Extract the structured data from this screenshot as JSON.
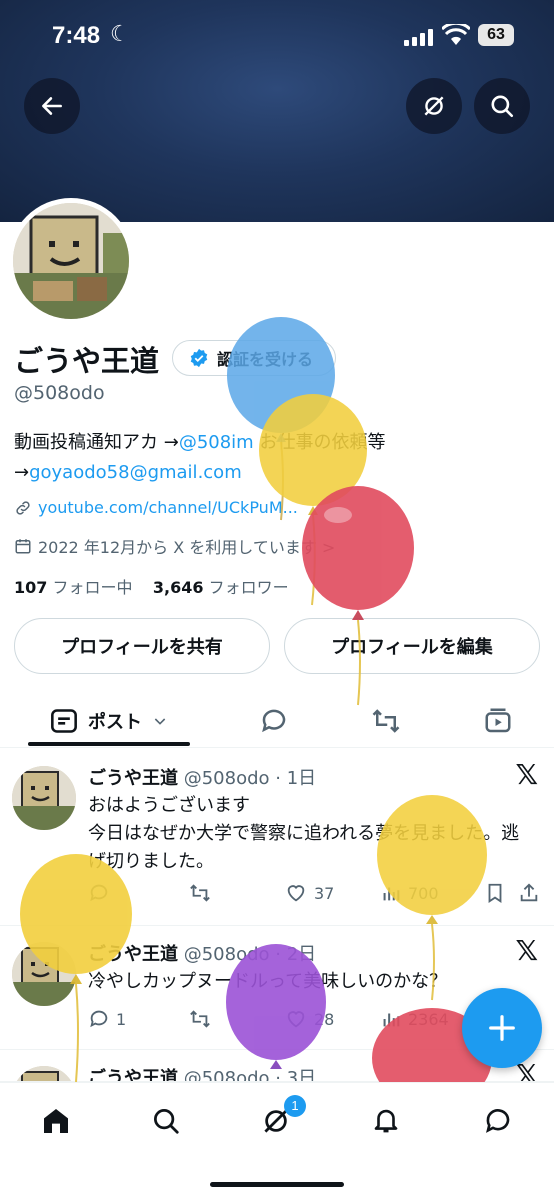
{
  "status_bar": {
    "time": "7:48",
    "battery": "63"
  },
  "profile": {
    "name": "ごうや王道",
    "verify_label": "認証を受ける",
    "handle": "@508odo",
    "bio_prefix": "動画投稿通知アカ →",
    "bio_link": "@508im",
    "bio_suffix": " お仕事の依頼等",
    "bio_line2_arrow": "→",
    "email": "goyaodo58@gmail.com",
    "website": "youtube.com/channel/UCkPuM...",
    "joined": "2022 年12月から X を利用しています >",
    "following_count": "107",
    "following_label": "フォロー中",
    "followers_count": "3,646",
    "followers_label": "フォロワー"
  },
  "buttons": {
    "share": "プロフィールを共有",
    "edit": "プロフィールを編集"
  },
  "tabs": {
    "posts": "ポスト"
  },
  "tweets": [
    {
      "name": "ごうや王道",
      "meta": "@508odo · 1日",
      "text": "おはようございます\n今日はなぜか大学で警察に追われる夢を見ました。逃げ切りました。",
      "replies": "",
      "retweets": "",
      "likes": "37",
      "views": "700"
    },
    {
      "name": "ごうや王道",
      "meta": "@508odo · 2日",
      "text": "冷やしカップヌードルって美味しいのかな？",
      "replies": "1",
      "retweets": "",
      "likes": "28",
      "views": "2364"
    },
    {
      "name": "ごうや王道",
      "meta": "@508odo · 3日",
      "text": "",
      "replies": "",
      "retweets": "",
      "likes": "",
      "views": ""
    }
  ],
  "nav": {
    "notifications_badge": "1"
  },
  "icons": [
    "back-arrow-icon",
    "grok-icon",
    "search-icon",
    "verified-badge-icon",
    "link-icon",
    "calendar-icon",
    "posts-tab-icon",
    "chevron-down-icon",
    "reply-tab-icon",
    "repost-tab-icon",
    "media-tab-icon",
    "x-logo-icon",
    "reply-icon",
    "repost-icon",
    "like-icon",
    "views-icon",
    "bookmark-icon",
    "share-icon",
    "compose-plus-icon",
    "home-icon",
    "grok-nav-icon",
    "notifications-icon",
    "messages-icon"
  ],
  "colors": {
    "accent": "#1d9bf0",
    "text": "#0f1419",
    "muted": "#536471",
    "banner": "#1f355c"
  }
}
